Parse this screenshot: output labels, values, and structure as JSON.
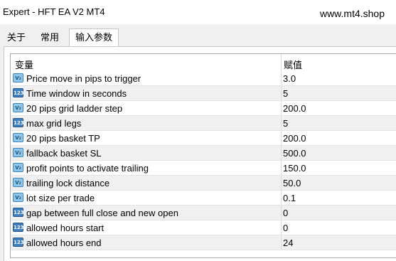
{
  "window": {
    "title": "Expert - HFT EA V2 MT4",
    "watermark": "www.mt4.shop"
  },
  "tabs": [
    {
      "label": "关于",
      "active": false
    },
    {
      "label": "常用",
      "active": false
    },
    {
      "label": "输入参数",
      "active": true
    }
  ],
  "table": {
    "headers": {
      "variable": "变量",
      "value": "赋值"
    },
    "rows": [
      {
        "icon": "ab-type-icon",
        "name": "Price move in pips to trigger",
        "value": "3.0"
      },
      {
        "icon": "int-type-icon",
        "name": "Time window in seconds",
        "value": "5"
      },
      {
        "icon": "ab-type-icon",
        "name": "20 pips grid ladder step",
        "value": "200.0"
      },
      {
        "icon": "int-type-icon",
        "name": "max grid legs",
        "value": "5"
      },
      {
        "icon": "ab-type-icon",
        "name": "20 pips basket TP",
        "value": "200.0"
      },
      {
        "icon": "ab-type-icon",
        "name": "fallback basket SL",
        "value": "500.0"
      },
      {
        "icon": "ab-type-icon",
        "name": "profit points to activate trailing",
        "value": "150.0"
      },
      {
        "icon": "ab-type-icon",
        "name": "trailing lock distance",
        "value": "50.0"
      },
      {
        "icon": "ab-type-icon",
        "name": "lot size per trade",
        "value": "0.1"
      },
      {
        "icon": "int-type-icon",
        "name": "gap between full close and new open",
        "value": "0"
      },
      {
        "icon": "int-type-icon",
        "name": "allowed hours start",
        "value": "0"
      },
      {
        "icon": "int-type-icon",
        "name": "allowed hours end",
        "value": "24"
      }
    ]
  }
}
